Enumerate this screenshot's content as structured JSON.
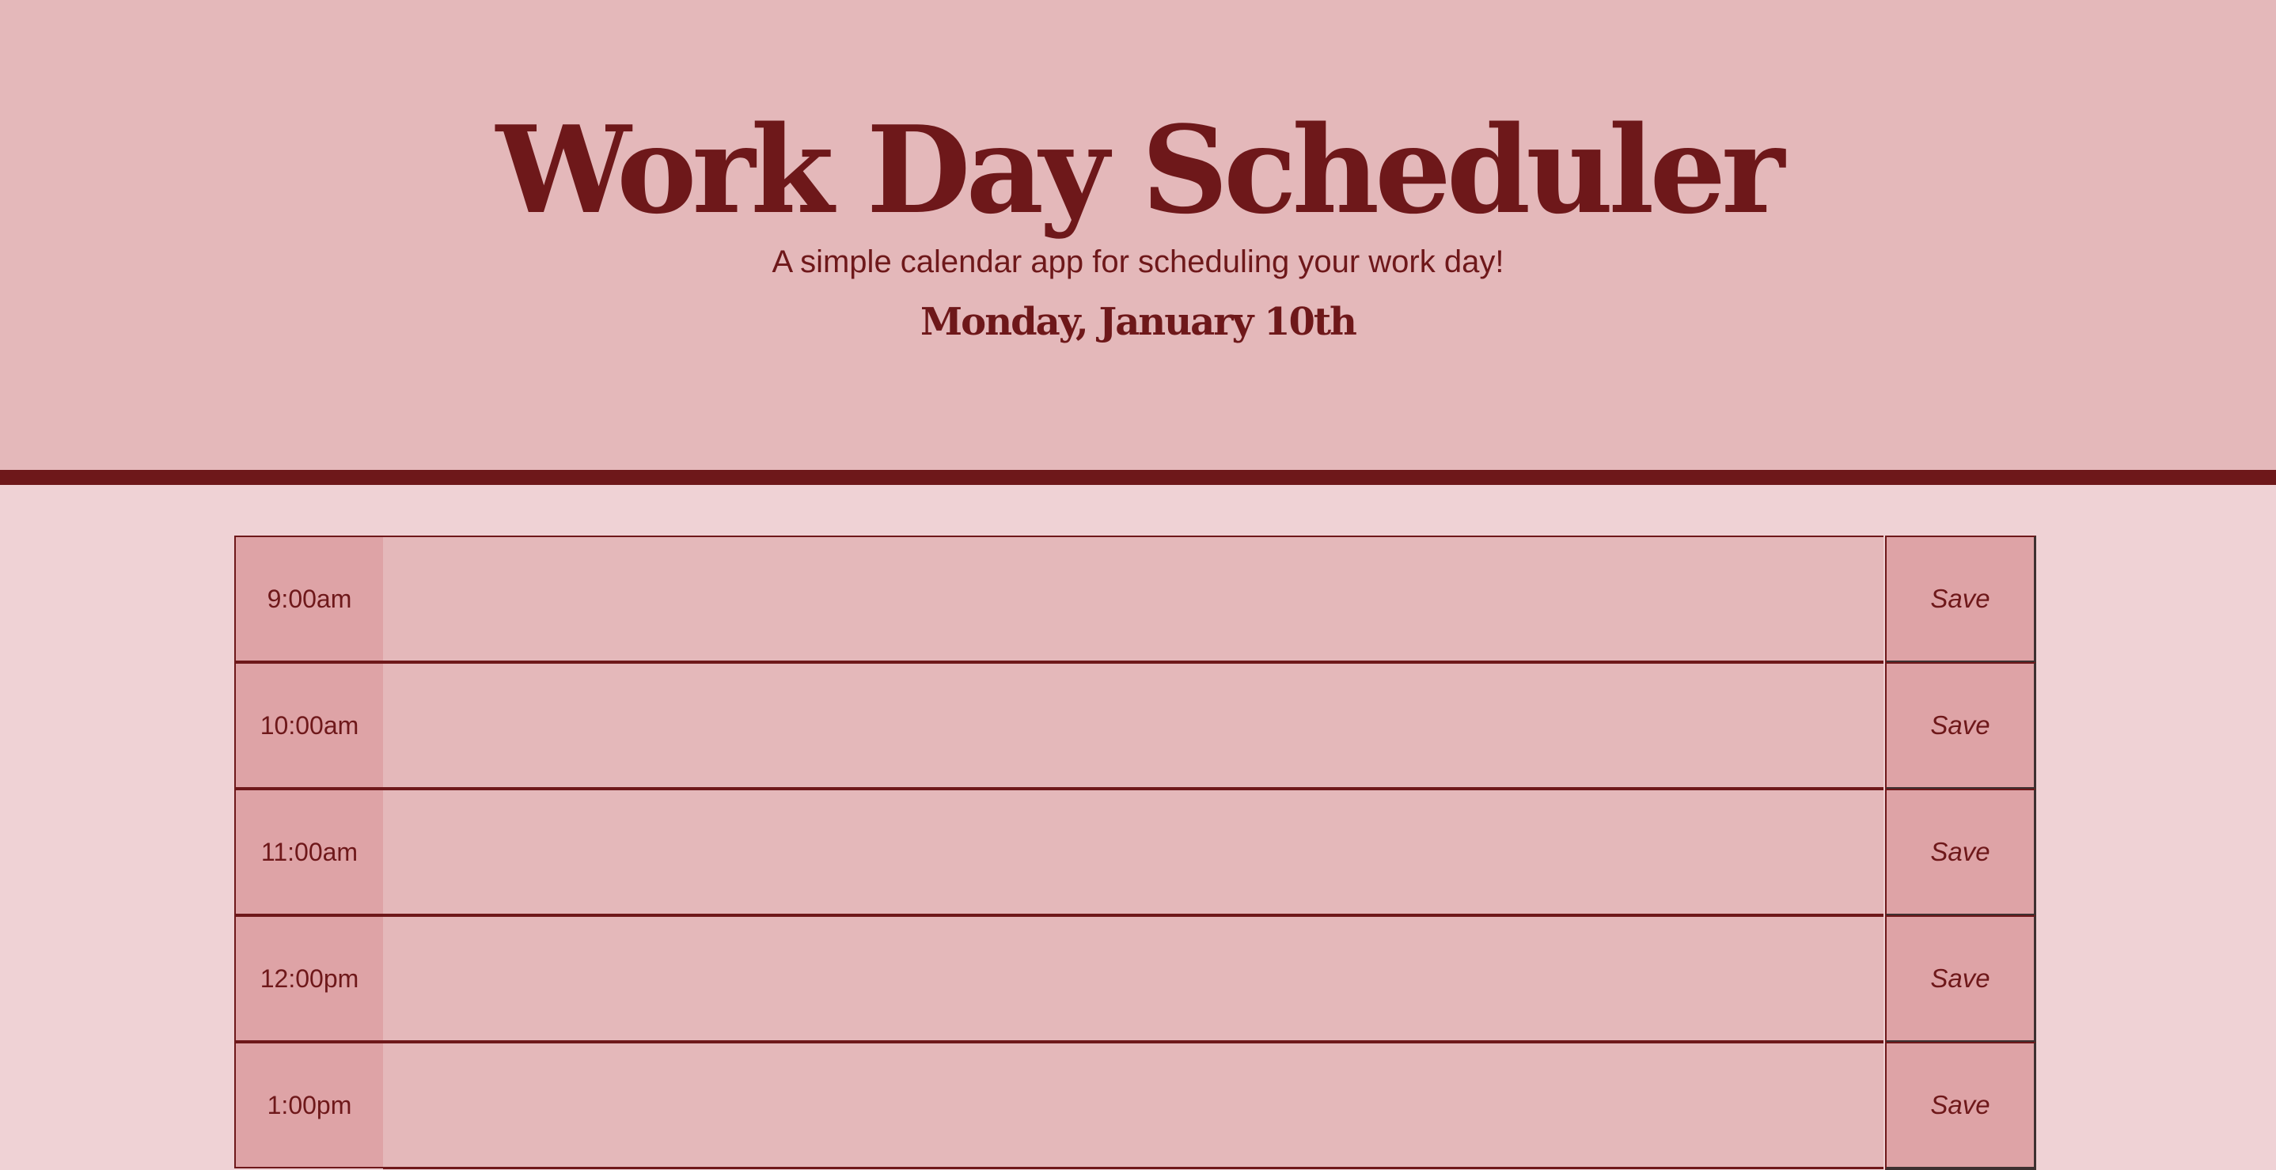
{
  "header": {
    "title": "Work Day Scheduler",
    "subtitle": "A simple calendar app for scheduling your work day!",
    "current_date": "Monday, January 10th"
  },
  "time_blocks": [
    {
      "hour": "9:00am",
      "description": "",
      "save_label": "Save"
    },
    {
      "hour": "10:00am",
      "description": "",
      "save_label": "Save"
    },
    {
      "hour": "11:00am",
      "description": "",
      "save_label": "Save"
    },
    {
      "hour": "12:00pm",
      "description": "",
      "save_label": "Save"
    },
    {
      "hour": "1:00pm",
      "description": "",
      "save_label": "Save"
    }
  ],
  "colors": {
    "header_bg": "#e4b8ba",
    "page_bg": "#efd2d5",
    "accent": "#6e181a",
    "hour_bg": "#dea3a6",
    "description_bg": "#e4b8ba"
  }
}
